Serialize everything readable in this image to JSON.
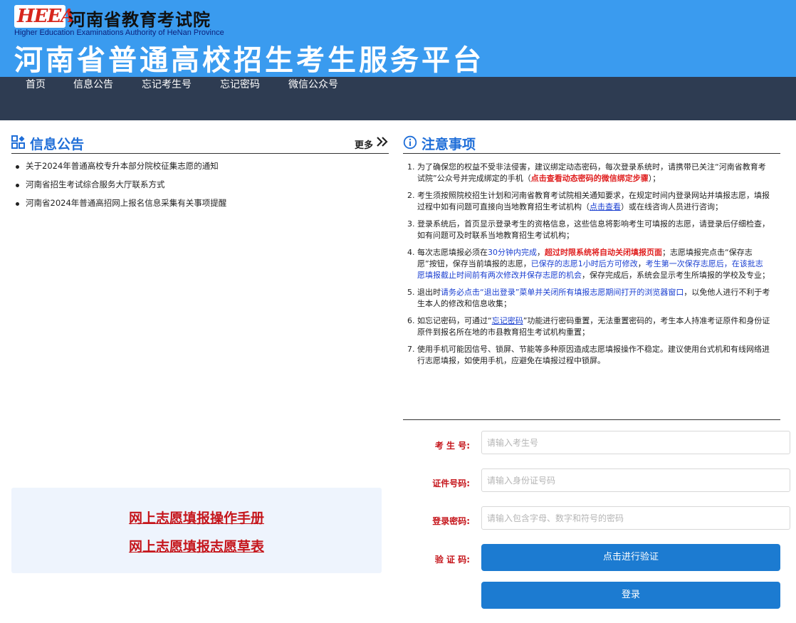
{
  "header": {
    "logo_text": "HEEA",
    "org_name_cn": "河南省教育考试院",
    "org_name_en": "Higher Education Examinations Authority of HeNan Province",
    "site_title": "河南省普通高校招生考生服务平台"
  },
  "nav": {
    "items": [
      "首页",
      "信息公告",
      "忘记考生号",
      "忘记密码",
      "微信公众号"
    ]
  },
  "announcements": {
    "title": "信息公告",
    "more_label": "更多",
    "items": [
      "关于2024年普通高校专升本部分院校征集志愿的通知",
      "河南省招生考试综合服务大厅联系方式",
      "河南省2024年普通高招网上报名信息采集有关事项提醒"
    ]
  },
  "manuals": {
    "link1": "网上志愿填报操作手册",
    "link2": "网上志愿填报志愿草表"
  },
  "notices": {
    "title": "注意事项",
    "item1": {
      "num": "1.",
      "text_a": "为了确保您的权益不受非法侵害，建议绑定动态密码，每次登录系统时，请携带已关注“河南省教育考试院”公众号并完成绑定的手机（",
      "red_a": "点击查看动态密码的微信绑定步骤",
      "text_b": "）；"
    },
    "item2": {
      "num": "2.",
      "text_a": "考生须按照院校招生计划和河南省教育考试院相关通知要求，在规定时间内登录网站并填报志愿，填报过程中如有问题可直接向当地教育招生考试机构（",
      "link_a": "点击查看",
      "text_b": "）或在线咨询人员进行咨询；"
    },
    "item3": {
      "num": "3.",
      "text_a": "登录系统后，首页显示登录考生的资格信息，这些信息将影响考生可填报的志愿，请登录后仔细检查，如有问题可及时联系当地教育招生考试机构；"
    },
    "item4": {
      "num": "4.",
      "text_a": "每次志愿填报必须在",
      "blue_a": "30分钟内完成",
      "text_b": "，",
      "red_a": "超过时限系统将自动关闭填报页面",
      "text_c": "；志愿填报完点击“保存志愿”按钮，保存当前填报的志愿，",
      "blue_b": "已保存的志愿1小时后方可修改",
      "text_d": "，",
      "blue_c": "考生第一次保存志愿后，在该批志愿填报截止时间前有两次修改并保存志愿的机会",
      "text_e": "，保存完成后，系统会显示考生所填报的学校及专业；"
    },
    "item5": {
      "num": "5.",
      "text_a": "退出时",
      "blue_a": "请务必点击“退出登录”菜单并关闭所有填报志愿期间打开的浏览器窗口",
      "text_b": "，以免他人进行不利于考生本人的修改和信息收集；"
    },
    "item6": {
      "num": "6.",
      "text_a": "如忘记密码，可通过“",
      "link_a": "忘记密码",
      "text_b": "”功能进行密码重置，无法重置密码的，考生本人持准考证原件和身份证原件到报名所在地的市县教育招生考试机构重置；"
    },
    "item7": {
      "num": "7.",
      "text_a": "使用手机可能因信号、锁屏、节能等多种原因造成志愿填报操作不稳定。建议使用台式机和有线网络进行志愿填报，如使用手机，应避免在填报过程中锁屏。"
    }
  },
  "login": {
    "exam_no_label": "考 生 号:",
    "exam_no_placeholder": "请输入考生号",
    "id_label": "证件号码:",
    "id_placeholder": "请输入身份证号码",
    "password_label": "登录密码:",
    "password_placeholder": "请输入包含字母、数字和符号的密码",
    "captcha_label": "验 证 码:",
    "verify_button": "点击进行验证",
    "login_button": "登录"
  },
  "colors": {
    "header_bg": "#3a9bef",
    "nav_bg": "#2e3c52",
    "title_blue": "#1f6ed8",
    "label_red": "#c5151b",
    "button_blue": "#1c7bd1"
  }
}
